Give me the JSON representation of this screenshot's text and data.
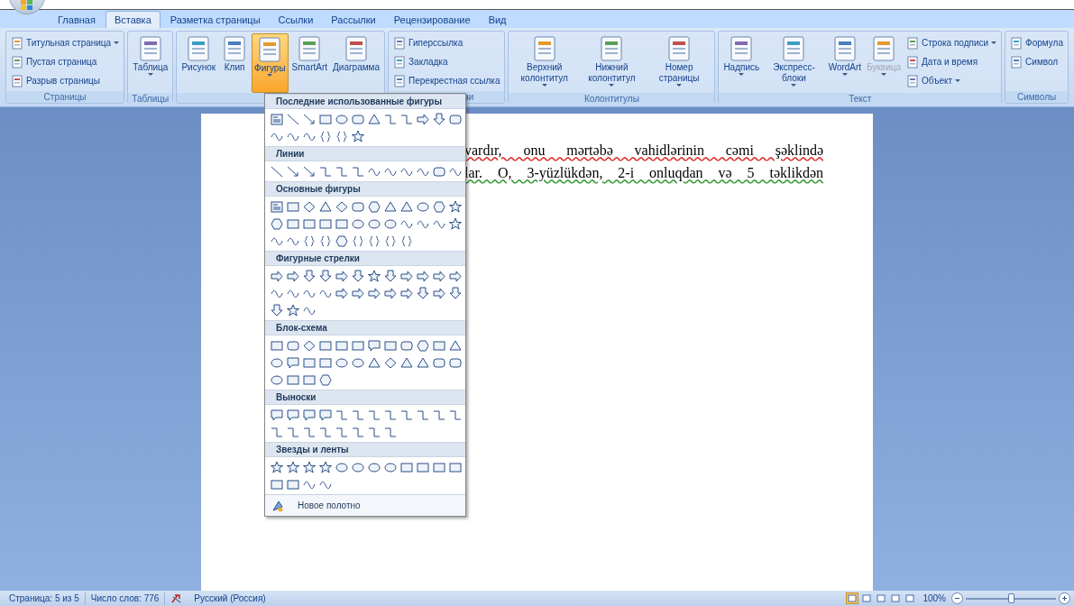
{
  "tabs": [
    {
      "label": "Главная",
      "selected": false
    },
    {
      "label": "Вставка",
      "selected": true
    },
    {
      "label": "Разметка страницы",
      "selected": false
    },
    {
      "label": "Ссылки",
      "selected": false
    },
    {
      "label": "Рассылки",
      "selected": false
    },
    {
      "label": "Рецензирование",
      "selected": false
    },
    {
      "label": "Вид",
      "selected": false
    }
  ],
  "ribbon_groups": [
    {
      "label": "Страницы",
      "items": [
        {
          "kind": "small",
          "label": "Титульная страница",
          "dropdown": true
        },
        {
          "kind": "small",
          "label": "Пустая страница",
          "dropdown": false
        },
        {
          "kind": "small",
          "label": "Разрыв страницы",
          "dropdown": false
        }
      ]
    },
    {
      "label": "Таблицы",
      "items": [
        {
          "kind": "large",
          "label": "Таблица",
          "dropdown": true,
          "active": false,
          "disabled": false
        }
      ]
    },
    {
      "items": [
        {
          "kind": "large",
          "label": "Рисунок",
          "dropdown": false,
          "active": false,
          "disabled": false
        },
        {
          "kind": "large",
          "label": "Клип",
          "dropdown": false,
          "active": false,
          "disabled": false
        },
        {
          "kind": "large",
          "label": "Фигуры",
          "dropdown": true,
          "active": true,
          "disabled": false
        },
        {
          "kind": "large",
          "label": "SmartArt",
          "dropdown": false,
          "active": false,
          "disabled": false
        },
        {
          "kind": "large",
          "label": "Диаграмма",
          "dropdown": false,
          "active": false,
          "disabled": false
        }
      ]
    },
    {
      "label": "зи",
      "items": [
        {
          "kind": "small",
          "label": "Гиперссылка",
          "dropdown": false
        },
        {
          "kind": "small",
          "label": "Закладка",
          "dropdown": false
        },
        {
          "kind": "small",
          "label": "Перекрестная ссылка",
          "dropdown": false
        }
      ]
    },
    {
      "label": "Колонтитулы",
      "items": [
        {
          "kind": "large",
          "label": "Верхний колонтитул",
          "dropdown": true,
          "active": false,
          "disabled": false
        },
        {
          "kind": "large",
          "label": "Нижний колонтитул",
          "dropdown": true,
          "active": false,
          "disabled": false
        },
        {
          "kind": "large",
          "label": "Номер страницы",
          "dropdown": true,
          "active": false,
          "disabled": false
        }
      ]
    },
    {
      "label": "Текст",
      "items": [
        {
          "kind": "large",
          "label": "Надпись",
          "dropdown": true,
          "active": false,
          "disabled": false
        },
        {
          "kind": "large",
          "label": "Экспресс-блоки",
          "dropdown": true,
          "active": false,
          "disabled": false
        },
        {
          "kind": "large",
          "label": "WordArt",
          "dropdown": true,
          "active": false,
          "disabled": false
        },
        {
          "kind": "large",
          "label": "Буквица",
          "dropdown": true,
          "active": false,
          "disabled": true
        },
        {
          "kind": "small",
          "label": "Строка подписи",
          "dropdown": true
        },
        {
          "kind": "small",
          "label": "Дата и время",
          "dropdown": false
        },
        {
          "kind": "small",
          "label": "Объект",
          "dropdown": true
        }
      ]
    },
    {
      "label": "Символы",
      "items": [
        {
          "kind": "small",
          "label": "Формула",
          "dropdown": false
        },
        {
          "kind": "small",
          "label": "Символ",
          "dropdown": false
        }
      ]
    }
  ],
  "document_lines": [
    {
      "text": "vardır, onu mərtəbə vahidlərinin cəmi şəklində",
      "kind": "spelling"
    },
    {
      "text": "lar. O, 3-yüzlükdən, 2-i onluqdan və 5 təklikdən",
      "kind": "grammar"
    }
  ],
  "shapes_menu": {
    "sections": [
      {
        "title": "Последние использованные фигуры"
      },
      {
        "title": "Линии"
      },
      {
        "title": "Основные фигуры"
      },
      {
        "title": "Фигурные стрелки"
      },
      {
        "title": "Блок-схема"
      },
      {
        "title": "Выноски"
      },
      {
        "title": "Звезды и ленты"
      }
    ],
    "footer": "Новое полотно"
  },
  "status_bar": {
    "page": "Страница: 5 из 5",
    "words": "Число слов: 776",
    "language": "Русский (Россия)",
    "zoom": "100%",
    "zoom_level": {
      "level": 0.5
    }
  }
}
